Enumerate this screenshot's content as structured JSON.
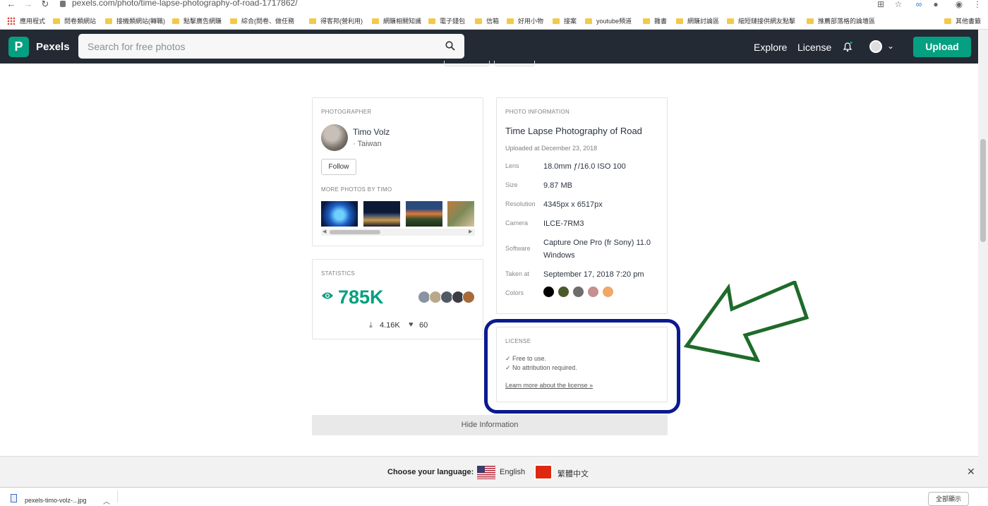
{
  "browser": {
    "url": "pexels.com/photo/time-lapse-photography-of-road-1717862/",
    "bookmarks": [
      "應用程式",
      "問卷類網站",
      "接機類網站(轉職)",
      "點擊廣告網賺",
      "綜合(問卷、做任務",
      "得客邦(營利用)",
      "網賺相關知識",
      "電子錢包",
      "信箱",
      "好用小物",
      "接案",
      "youtube頻道",
      "雜書",
      "網賺討論區",
      "縮短鏈接供網友點擊",
      "推薦部落格的論壇區",
      "其他書籤"
    ]
  },
  "header": {
    "logo_letter": "P",
    "brand": "Pexels",
    "search_placeholder": "Search for free photos",
    "nav": [
      "Explore",
      "License"
    ],
    "upload_label": "Upload"
  },
  "photographer": {
    "caption": "PHOTOGRAPHER",
    "name": "Timo Volz",
    "location": "· Taiwan",
    "follow_label": "Follow",
    "more_caption": "MORE PHOTOS BY TIMO"
  },
  "statistics": {
    "caption": "STATISTICS",
    "views": "785K",
    "downloads": "4.16K",
    "likes": "60"
  },
  "photo_info": {
    "caption": "PHOTO INFORMATION",
    "title": "Time Lapse Photography of Road",
    "uploaded": "Uploaded at December 23, 2018",
    "rows": [
      {
        "label": "Lens",
        "value": "18.0mm ƒ/16.0 ISO 100"
      },
      {
        "label": "Size",
        "value": "9.87 MB"
      },
      {
        "label": "Resolution",
        "value": "4345px x 6517px"
      },
      {
        "label": "Camera",
        "value": "ILCE-7RM3"
      },
      {
        "label": "Software",
        "value": "Capture One Pro (fr Sony) 11.0 Windows"
      },
      {
        "label": "Taken at",
        "value": "September 17, 2018 7:20 pm"
      }
    ],
    "colors_label": "Colors",
    "colors": [
      "#000000",
      "#4b5a2a",
      "#6d6d6d",
      "#c49090",
      "#f0a868"
    ]
  },
  "license": {
    "caption": "LICENSE",
    "line1": "✓ Free to use.",
    "line2": "✓ No attribution required.",
    "link": "Learn more about the license »"
  },
  "hide_info_label": "Hide Information",
  "language_bar": {
    "label": "Choose your language:",
    "english": "English",
    "chinese": "繁體中文"
  },
  "download_shelf": {
    "file": "pexels-timo-volz-...jpg",
    "show_all": "全部顯示"
  },
  "annotation": {
    "frame_color": "#0b1a8f",
    "arrow_color": "#1e6b2a"
  }
}
